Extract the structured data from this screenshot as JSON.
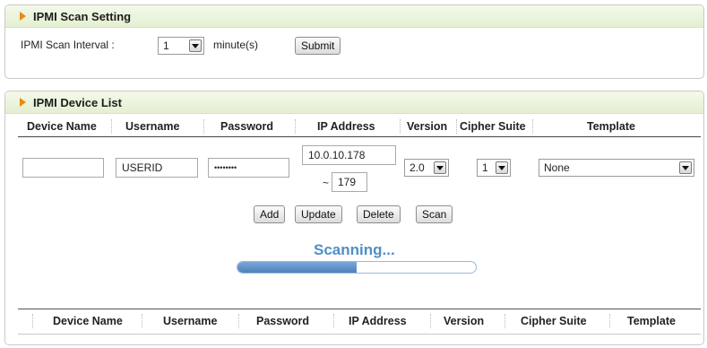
{
  "scan_setting": {
    "title": "IPMI Scan Setting",
    "interval_label": "IPMI Scan Interval :",
    "interval_value": "1",
    "unit_label": "minute(s)",
    "submit_label": "Submit"
  },
  "device_list": {
    "title": "IPMI Device List",
    "columns": [
      "Device Name",
      "Username",
      "Password",
      "IP Address",
      "Version",
      "Cipher Suite",
      "Template"
    ],
    "form": {
      "device_name": "",
      "username": "USERID",
      "password": "••••••••",
      "ip_start": "10.0.10.178",
      "range_sep": "~",
      "ip_end": "179",
      "version": "2.0",
      "cipher_suite": "1",
      "template": "None"
    },
    "buttons": {
      "add": "Add",
      "update": "Update",
      "delete": "Delete",
      "scan": "Scan"
    },
    "scan_status": "Scanning...",
    "scan_progress": 0.5,
    "table_columns": [
      "Device Name",
      "Username",
      "Password",
      "IP Address",
      "Version",
      "Cipher Suite",
      "Template"
    ]
  },
  "colors": {
    "accent": "#e98b11",
    "progress": "#5d8fc7",
    "status_text": "#4f8fc8"
  }
}
